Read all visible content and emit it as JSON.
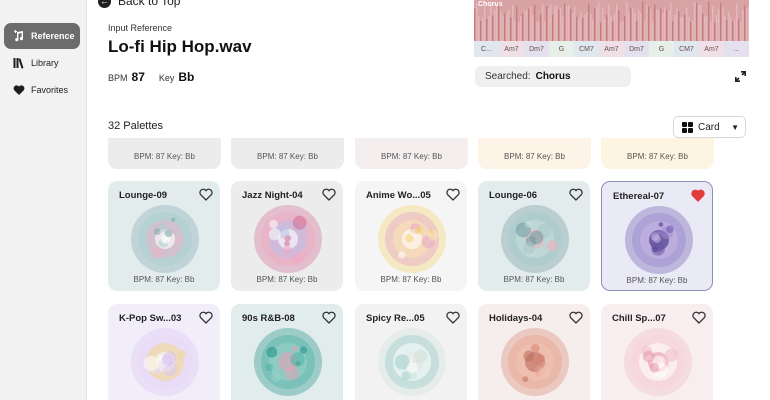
{
  "sidebar": {
    "items": [
      {
        "label": "Reference",
        "icon": "music-note-plus-icon",
        "active": true
      },
      {
        "label": "Library",
        "icon": "library-icon",
        "active": false
      },
      {
        "label": "Favorites",
        "icon": "heart-icon",
        "active": false
      }
    ]
  },
  "header": {
    "back_label": "Back to Top",
    "input_caption": "Input Reference",
    "file_name": "Lo-fi Hip Hop.wav",
    "bpm_label": "BPM",
    "bpm_value": "87",
    "key_label": "Key",
    "key_value": "Bb"
  },
  "waveform": {
    "section_label": "Chorus",
    "chords": [
      "C...",
      "Am7",
      "Dm7",
      "G",
      "CM7",
      "Am7",
      "Dm7",
      "G",
      "CM7",
      "Am7",
      "..."
    ]
  },
  "search": {
    "prefix": "Searched:",
    "value": "Chorus"
  },
  "results": {
    "count_label": "32 Palettes",
    "view_mode": "Card"
  },
  "stubs": [
    "BPM: 87 Key: Bb",
    "BPM: 87 Key: Bb",
    "BPM: 87 Key: Bb",
    "BPM: 87 Key: Bb",
    "BPM: 87 Key: Bb"
  ],
  "cards": [
    {
      "title": "Lounge-09",
      "bpm_key": "BPM: 87 Key: Bb",
      "favorite": false,
      "bg": "#e3eced"
    },
    {
      "title": "Jazz Night-04",
      "bpm_key": "BPM: 87 Key: Bb",
      "favorite": false,
      "bg": "#ececec"
    },
    {
      "title": "Anime Wo...05",
      "bpm_key": "BPM: 87 Key: Bb",
      "favorite": false,
      "bg": "#f5f5f5"
    },
    {
      "title": "Lounge-06",
      "bpm_key": "BPM: 87 Key: Bb",
      "favorite": false,
      "bg": "#e3eced"
    },
    {
      "title": "Ethereal-07",
      "bpm_key": "BPM: 87 Key: Bb",
      "favorite": true,
      "bg": "#e9eaf6"
    },
    {
      "title": "K-Pop Sw...03",
      "bpm_key": "",
      "favorite": false,
      "bg": "#f1eefa"
    },
    {
      "title": "90s R&B-08",
      "bpm_key": "",
      "favorite": false,
      "bg": "#e1ecec"
    },
    {
      "title": "Spicy Re...05",
      "bpm_key": "",
      "favorite": false,
      "bg": "#f2f2f2"
    },
    {
      "title": "Holidays-04",
      "bpm_key": "",
      "favorite": false,
      "bg": "#f5eeec"
    },
    {
      "title": "Chill Sp...07",
      "bpm_key": "",
      "favorite": false,
      "bg": "#f8eef0"
    }
  ],
  "colors": {
    "sidebar_active": "#6c6c6c",
    "favorite_red": "#e23b3b",
    "waveform": "#d9a3a5"
  }
}
